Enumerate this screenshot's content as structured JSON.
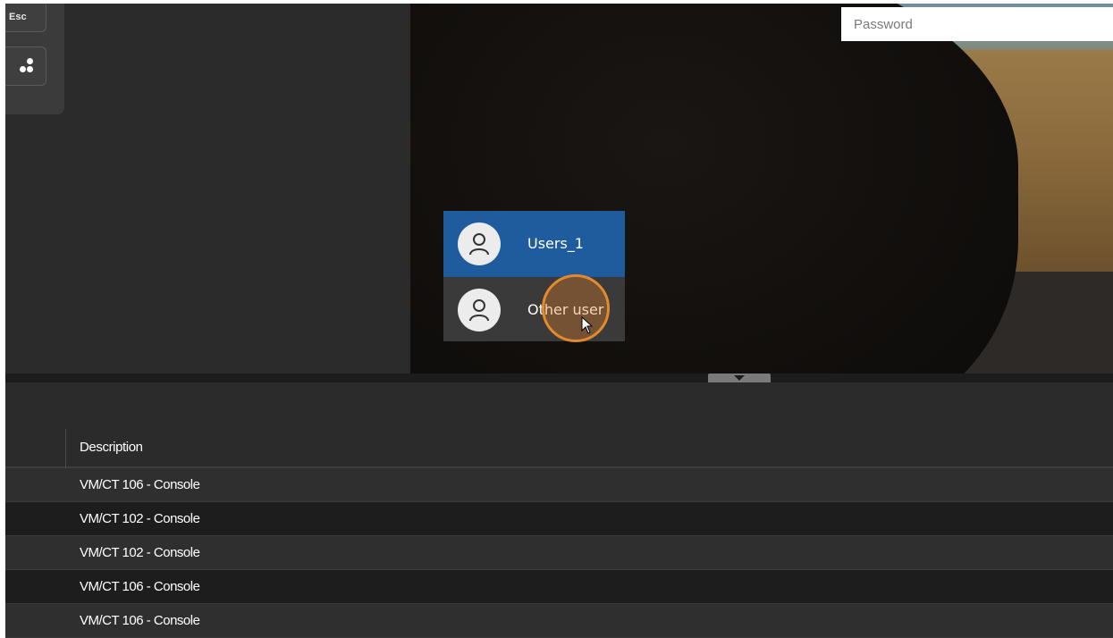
{
  "keys": {
    "esc_label": "Esc"
  },
  "login": {
    "password_placeholder": "Password",
    "users": [
      {
        "name": "Users_1",
        "selected": true
      },
      {
        "name": "Other user",
        "selected": false
      }
    ]
  },
  "tasks": {
    "header_description": "Description",
    "rows": [
      {
        "description": "VM/CT 106 - Console"
      },
      {
        "description": "VM/CT 102 - Console"
      },
      {
        "description": "VM/CT 102 - Console"
      },
      {
        "description": "VM/CT 106 - Console"
      },
      {
        "description": "VM/CT 106 - Console"
      }
    ]
  },
  "colors": {
    "selected_user_bg": "#1f5c9e",
    "click_ring": "#e38a2c",
    "panel_bg": "#2b2b2b"
  }
}
